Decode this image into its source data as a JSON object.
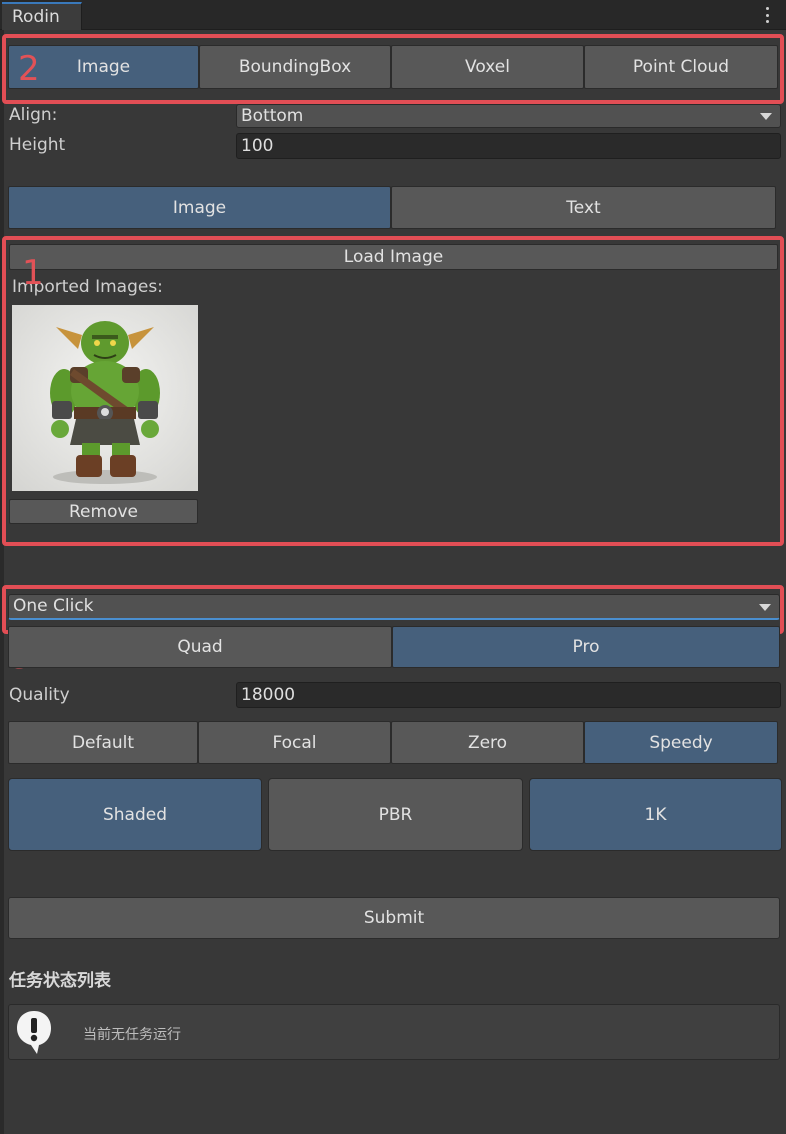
{
  "window": {
    "tab_title": "Rodin"
  },
  "mode_tabs": [
    "Image",
    "BoundingBox",
    "Voxel",
    "Point Cloud"
  ],
  "mode_selected": 0,
  "align": {
    "label": "Align:",
    "value": "Bottom"
  },
  "height": {
    "label": "Height",
    "value": "100"
  },
  "input_tabs": [
    "Image",
    "Text"
  ],
  "input_selected": 0,
  "load_image_label": "Load Image",
  "imported_images_label": "Imported Images:",
  "remove_label": "Remove",
  "generation_mode": {
    "value": "One Click"
  },
  "mesh_tabs": [
    "Quad",
    "Pro"
  ],
  "mesh_selected": 1,
  "quality": {
    "label": "Quality",
    "value": "18000"
  },
  "tier_tabs": [
    "Default",
    "Focal",
    "Zero",
    "Speedy"
  ],
  "tier_selected": 3,
  "material_buttons": [
    "Shaded",
    "PBR",
    "1K"
  ],
  "material_selected": [
    0,
    2
  ],
  "submit_label": "Submit",
  "task_list_title": "任务状态列表",
  "task_status_text": "当前无任务运行",
  "annotations": [
    "2",
    "1",
    "3"
  ],
  "colors": {
    "selected": "#46607c",
    "button": "#585858",
    "annotation": "#e24e55",
    "background": "#383838"
  },
  "icons": [
    "more-vert-icon",
    "dropdown-arrow-icon",
    "info-exclamation-icon"
  ]
}
